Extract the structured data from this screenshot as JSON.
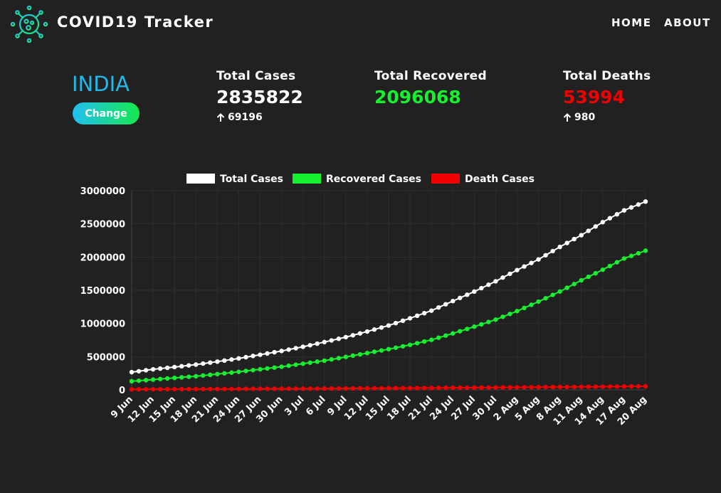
{
  "navbar": {
    "brand": "COVID19 Tracker",
    "logo_icon": "virus-icon",
    "links": [
      "HOME",
      "ABOUT"
    ]
  },
  "summary": {
    "country": "INDIA",
    "change_label": "Change",
    "total_cases": {
      "label": "Total Cases",
      "value": "2835822",
      "delta": "69196",
      "delta_icon": "arrow-up-icon",
      "color": "#ffffff"
    },
    "total_recovered": {
      "label": "Total Recovered",
      "value": "2096068",
      "color": "#16f02f"
    },
    "total_deaths": {
      "label": "Total Deaths",
      "value": "53994",
      "delta": "980",
      "delta_icon": "arrow-up-icon",
      "color": "#f00000"
    }
  },
  "chart_data": {
    "type": "line",
    "title": "",
    "xlabel": "",
    "ylabel": "",
    "ylim": [
      0,
      3000000
    ],
    "yticks": [
      "0",
      "500000",
      "1000000",
      "1500000",
      "2000000",
      "2500000",
      "3000000"
    ],
    "xticks": [
      "9 Jun",
      "12 Jun",
      "15 Jun",
      "18 Jun",
      "21 Jun",
      "24 Jun",
      "27 Jun",
      "30 Jun",
      "3 Jul",
      "6 Jul",
      "9 Jul",
      "12 Jul",
      "15 Jul",
      "18 Jul",
      "21 Jul",
      "24 Jul",
      "27 Jul",
      "30 Jul",
      "2 Aug",
      "5 Aug",
      "8 Aug",
      "11 Aug",
      "14 Aug",
      "17 Aug",
      "20 Aug"
    ],
    "x_start": "9 Jun",
    "x_end": "20 Aug",
    "grid": true,
    "legend_position": "top",
    "series": [
      {
        "name": "Total Cases",
        "color": "#ffffff",
        "values": [
          266598,
          308993,
          343091,
          380532,
          425282,
          473105,
          528859,
          585493,
          648315,
          719665,
          793802,
          878254,
          968876,
          1077618,
          1193078,
          1336861,
          1480073,
          1634746,
          1803695,
          1964536,
          2153010,
          2329638,
          2525922,
          2702742,
          2835822
        ]
      },
      {
        "name": "Recovered Cases",
        "color": "#16f02f",
        "values": [
          129215,
          154330,
          180013,
          204711,
          237196,
          271697,
          309713,
          347912,
          394227,
          439948,
          495513,
          553471,
          612768,
          677423,
          753050,
          849432,
          951166,
          1057805,
          1186203,
          1328336,
          1480884,
          1649638,
          1808936,
          1977779,
          2096068
        ]
      },
      {
        "name": "Death Cases",
        "color": "#f00000",
        "values": [
          7473,
          8884,
          9900,
          12237,
          13254,
          14476,
          16095,
          17400,
          18213,
          19693,
          21604,
          23174,
          24915,
          26816,
          28732,
          31358,
          33408,
          35747,
          38135,
          40699,
          42518,
          45257,
          48040,
          51045,
          53994
        ]
      }
    ]
  }
}
